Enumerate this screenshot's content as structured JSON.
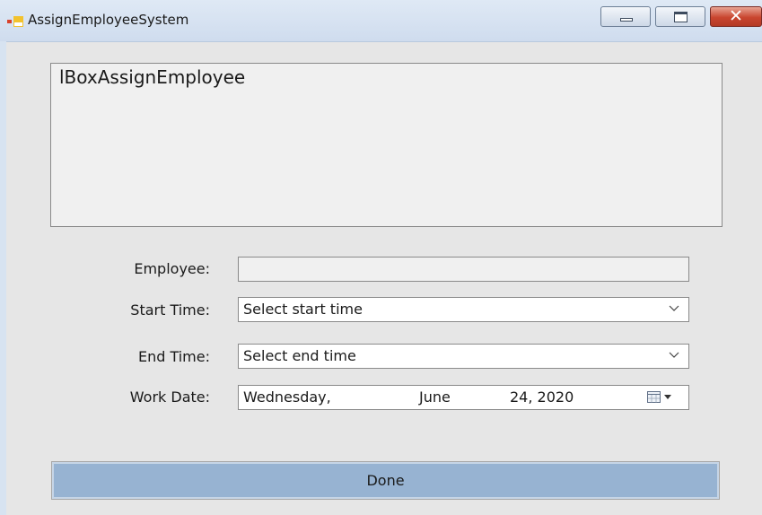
{
  "window": {
    "title": "AssignEmployeeSystem",
    "minimize_icon": "minimize-icon",
    "maximize_icon": "maximize-icon",
    "close_icon": "close-icon",
    "close_glyph": "✕"
  },
  "textbox": {
    "text": "lBoxAssignEmployee"
  },
  "form": {
    "employee_label": "Employee:",
    "employee_value": "",
    "start_time_label": "Start Time:",
    "start_time_value": "Select start time",
    "end_time_label": "End Time:",
    "end_time_value": "Select end time",
    "work_date_label": "Work Date:",
    "work_date_weekday": "Wednesday,",
    "work_date_month": "June",
    "work_date_daynum": "24, 2020"
  },
  "done_button": {
    "label": "Done"
  },
  "colors": {
    "done_button_bg": "#97b3d2",
    "close_button": "#c9452f",
    "window_bg": "#e6e6e6"
  }
}
